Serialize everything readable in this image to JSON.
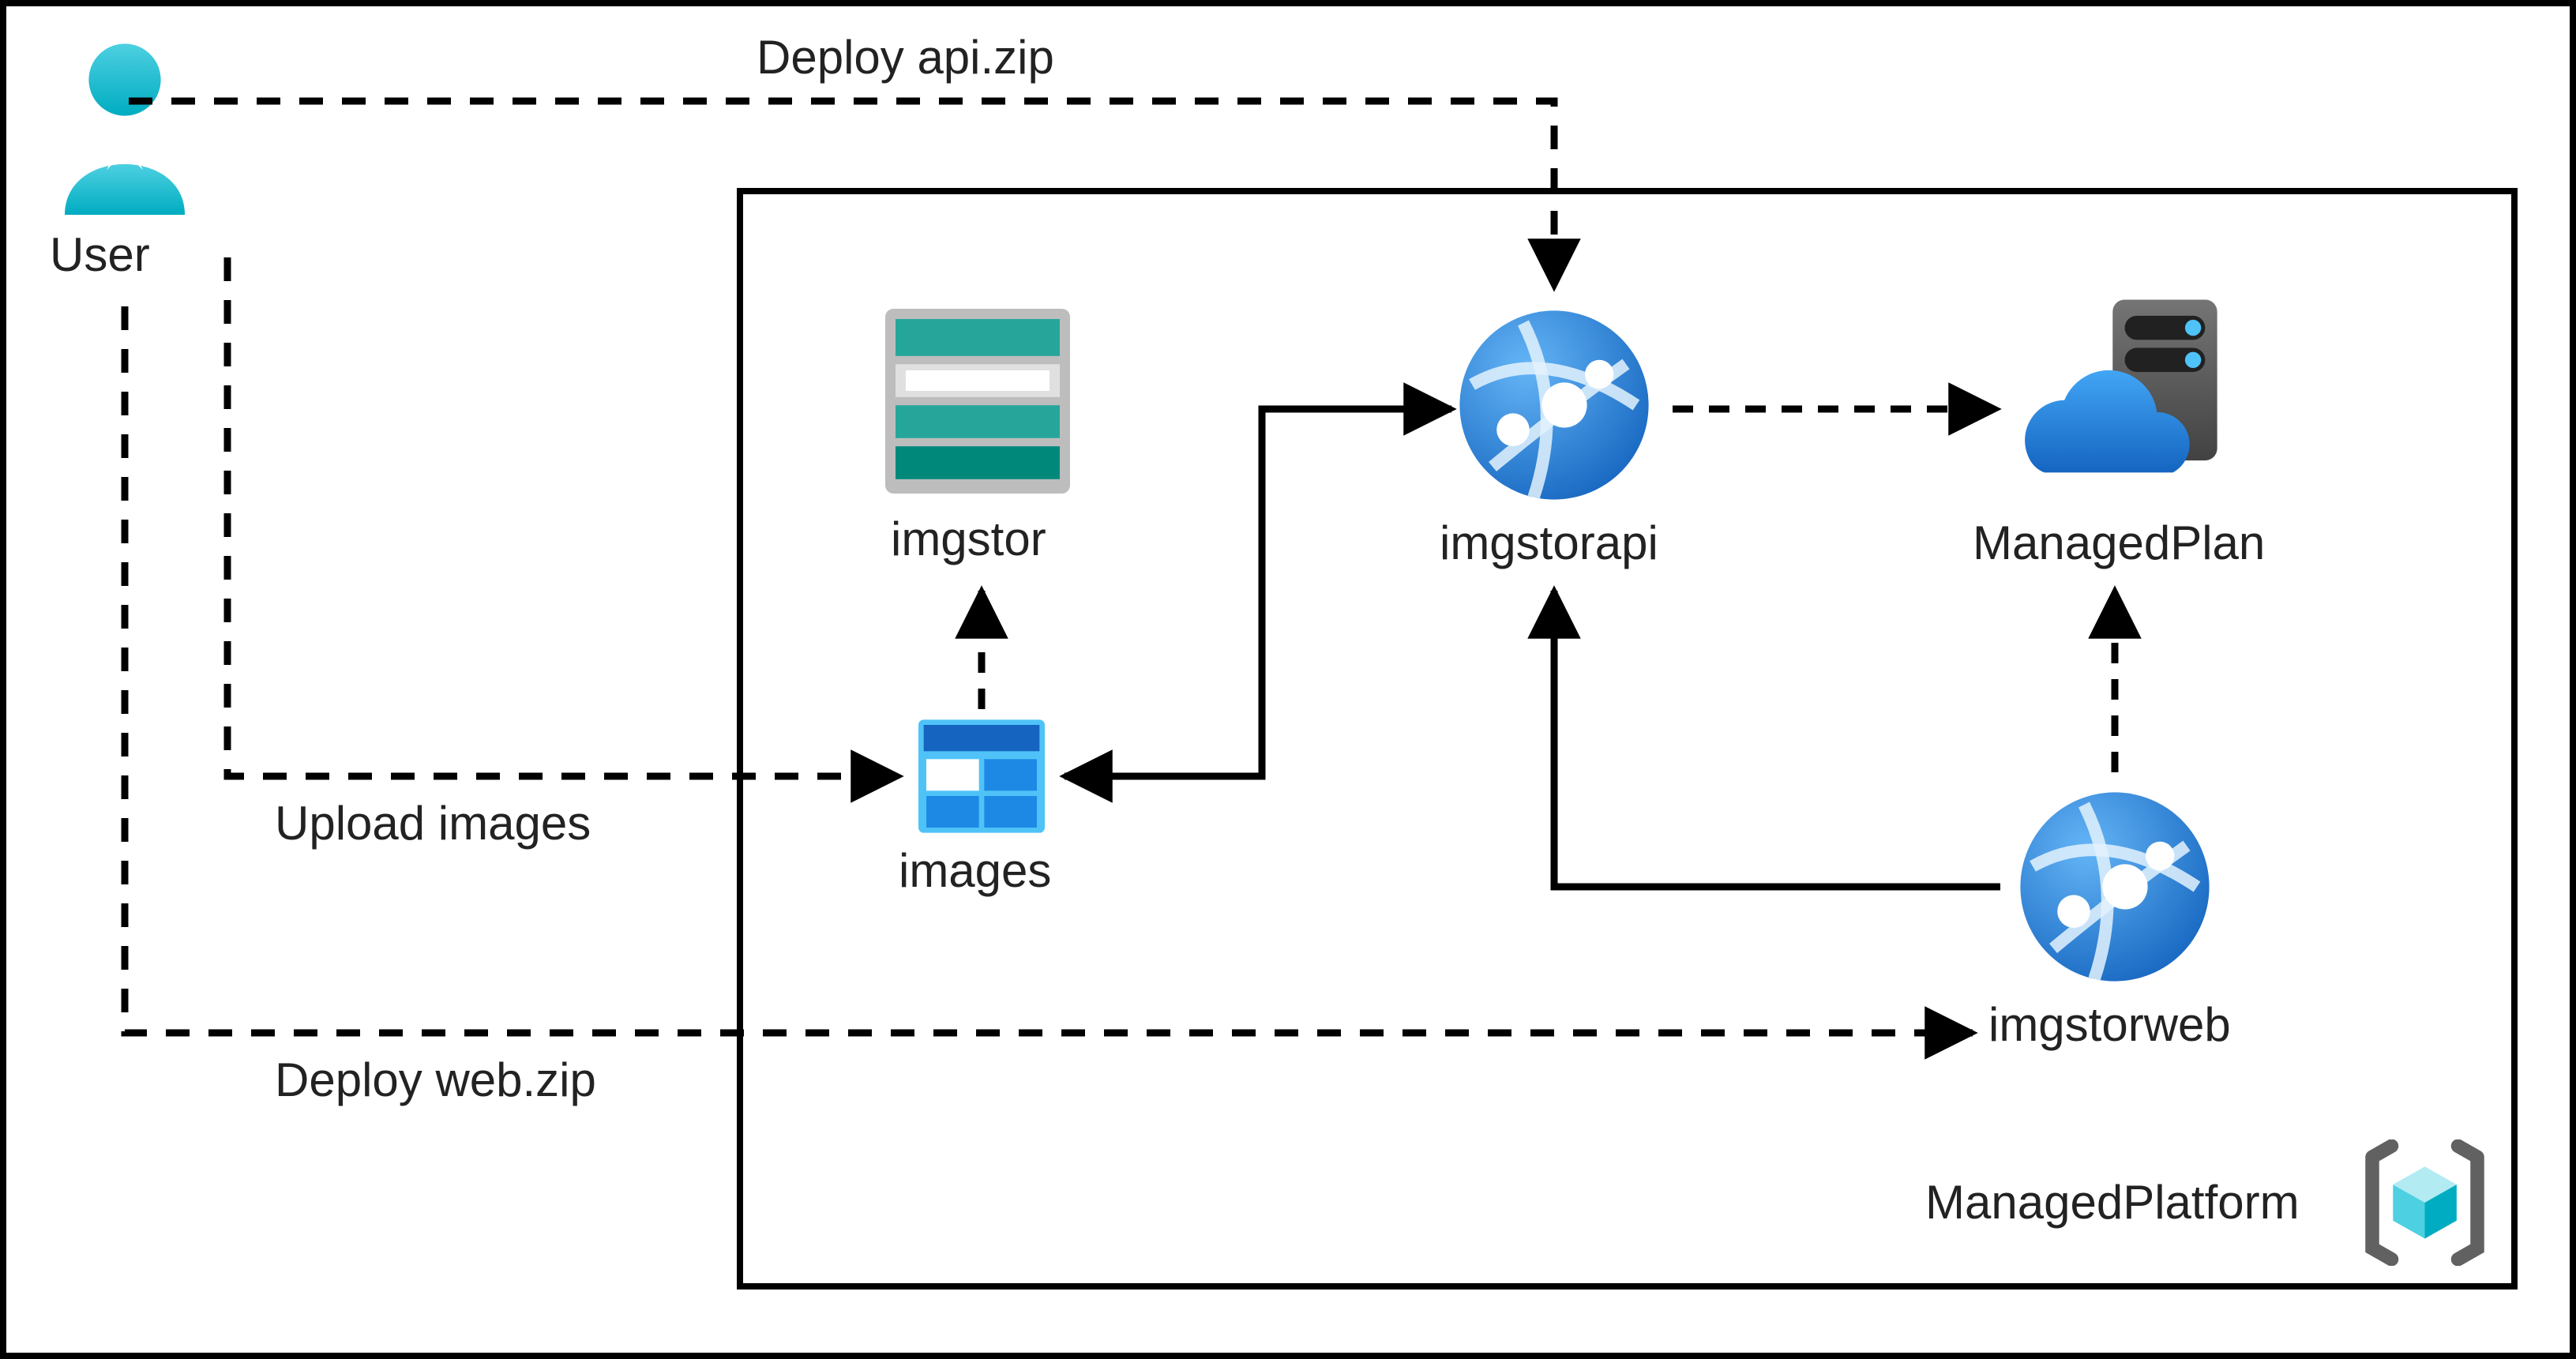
{
  "diagram": {
    "user_label": "User",
    "deploy_api_label": "Deploy api.zip",
    "deploy_web_label": "Deploy web.zip",
    "upload_images_label": "Upload images",
    "imgstor_label": "imgstor",
    "images_label": "images",
    "imgstorapi_label": "imgstorapi",
    "managedplan_label": "ManagedPlan",
    "imgstorweb_label": "imgstorweb",
    "managedplatform_label": "ManagedPlatform"
  },
  "colors": {
    "azure_blue": "#1e88e5",
    "azure_blue_light": "#4fc3f7",
    "teal": "#26a69a",
    "teal_dark": "#00796b",
    "gray": "#9e9e9e",
    "gray_dark": "#616161",
    "cyan": "#00bcd4"
  }
}
